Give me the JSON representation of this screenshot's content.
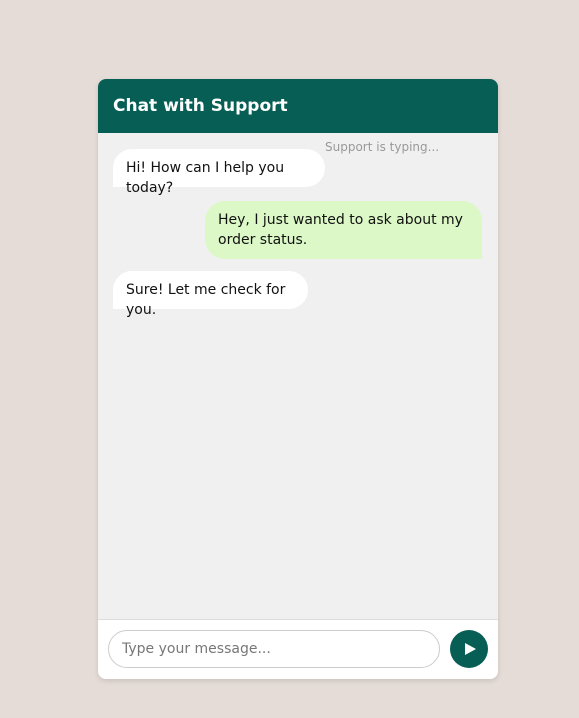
{
  "header": {
    "title": "Chat with Support"
  },
  "status": {
    "typing": "Support is typing..."
  },
  "messages": [
    {
      "sender": "support",
      "text": "Hi! How can I help you today?"
    },
    {
      "sender": "user",
      "text": "Hey, I just wanted to ask about my order status."
    },
    {
      "sender": "support",
      "text": "Sure! Let me check for you."
    }
  ],
  "composer": {
    "placeholder": "Type your message...",
    "value": "",
    "send_icon": "send-icon"
  },
  "colors": {
    "brand": "#075e54",
    "outgoing_bubble": "#dcf8c6",
    "incoming_bubble": "#ffffff",
    "chat_background": "#f0f0f0",
    "page_background": "#e5dcd7"
  }
}
